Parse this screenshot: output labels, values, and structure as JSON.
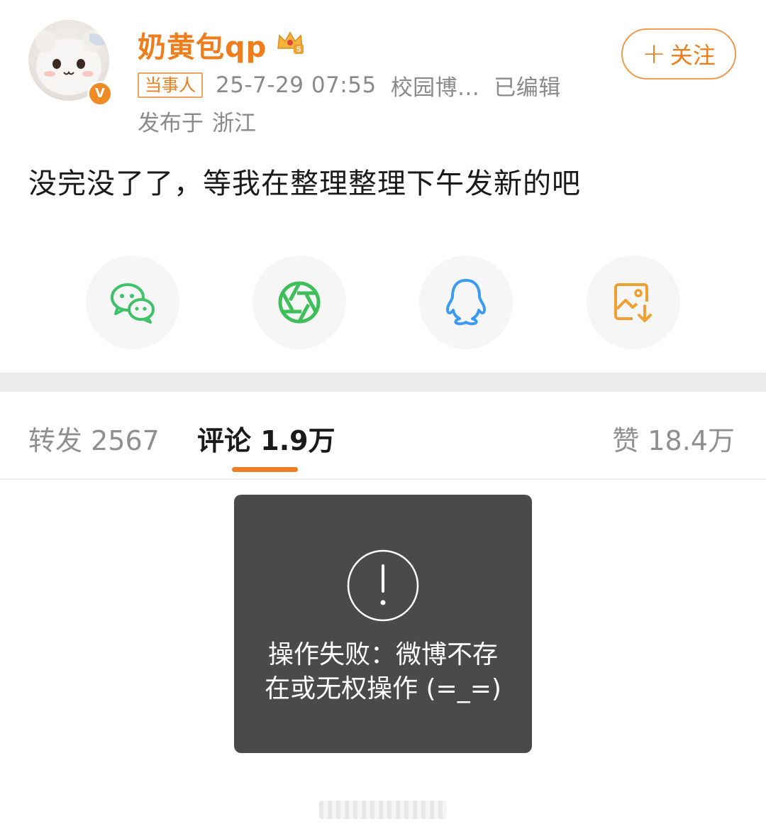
{
  "header": {
    "username": "奶黄包qp",
    "verified_badge": "V",
    "follow_label": "关注",
    "role_tag": "当事人",
    "timestamp": "25-7-29 07:55",
    "source": "校园博...",
    "edited": "已编辑",
    "location_prefix": "发布于",
    "location": "浙江"
  },
  "post": {
    "text": "没完没了了，等我在整理整理下午发新的吧"
  },
  "share": {
    "items": [
      {
        "name": "wechat-icon"
      },
      {
        "name": "moments-icon"
      },
      {
        "name": "qq-icon"
      },
      {
        "name": "save-image-icon"
      }
    ]
  },
  "tabs": {
    "repost_label": "转发",
    "repost_count": "2567",
    "comment_label": "评论",
    "comment_count": "1.9万",
    "like_label": "赞",
    "like_count": "18.4万"
  },
  "toast": {
    "line1": "操作失败：微博不存",
    "line2": "在或无权操作 (=_=)"
  },
  "colors": {
    "accent": "#ef7d1b",
    "wechat": "#3fc26a",
    "moments": "#3fbf5a",
    "qq": "#3a9bf0",
    "save": "#f0a030"
  }
}
